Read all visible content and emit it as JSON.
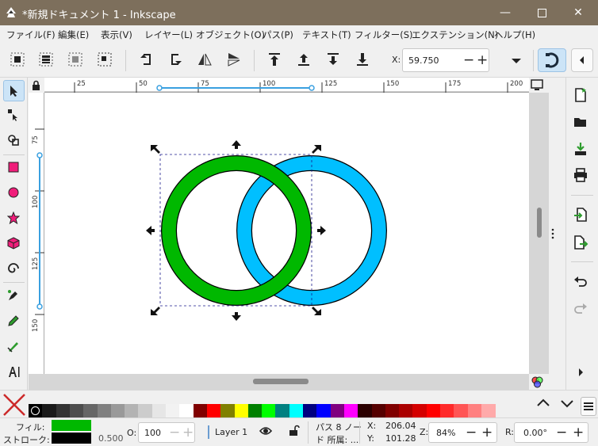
{
  "window": {
    "title": "*新規ドキュメント 1 - Inkscape"
  },
  "menu": [
    "ファイル(F)",
    "編集(E)",
    "表示(V)",
    "レイヤー(L)",
    "オブジェクト(O)",
    "パス(P)",
    "テキスト(T)",
    "フィルター(S)",
    "エクステンション(N)",
    "ヘルプ(H)"
  ],
  "toolbar": {
    "x_label": "X:",
    "x_value": "59.750"
  },
  "rulers": {
    "h_labels": [
      "25",
      "50",
      "75",
      "100",
      "125",
      "150",
      "175",
      "200"
    ],
    "v_labels": [
      "75",
      "100",
      "125",
      "150"
    ]
  },
  "canvas": {
    "circle_green": "#00b800",
    "circle_blue": "#00bfff",
    "selection_color": "#1b1b8c"
  },
  "palette": {
    "colors": [
      "#000000",
      "#1a1a1a",
      "#333333",
      "#4d4d4d",
      "#666666",
      "#808080",
      "#999999",
      "#b3b3b3",
      "#cccccc",
      "#e6e6e6",
      "#f2f2f2",
      "#ffffff",
      "#800000",
      "#ff0000",
      "#808000",
      "#ffff00",
      "#008000",
      "#00ff00",
      "#008080",
      "#00ffff",
      "#000080",
      "#0000ff",
      "#800080",
      "#ff00ff",
      "#2b0000",
      "#550000",
      "#800000",
      "#aa0000",
      "#d40000",
      "#ff0000",
      "#ff2a2a",
      "#ff5555",
      "#ff8080",
      "#ffaaaa"
    ]
  },
  "status": {
    "fill_label": "フィル:",
    "stroke_label": "ストローク:",
    "fill_color": "#00b800",
    "stroke_color": "#000000",
    "stroke_width": "0.500",
    "opacity_label": "O:",
    "opacity_value": "100",
    "layer": "Layer 1",
    "info_line1": "パス 8 ノー",
    "info_line2": "ド 所属: ...",
    "x_label": "X:",
    "x_value": "206.04",
    "y_label": "Y:",
    "y_value": "101.28",
    "zoom_label": "Z:",
    "zoom_value": "84%",
    "rotate_label": "R:",
    "rotate_value": "0.00°"
  }
}
